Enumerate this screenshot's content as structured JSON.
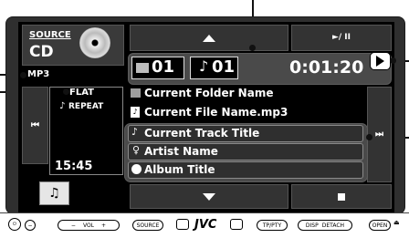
{
  "source": {
    "label": "SOURCE",
    "value": "CD"
  },
  "format": "MP3",
  "equalizer": "FLAT",
  "repeat": "REPEAT",
  "clock": "15:45",
  "folder_number": "01",
  "track_number": "01",
  "elapsed_time": "0:01:20",
  "folder_name": "Current Folder Name",
  "file_name": "Current File Name.mp3",
  "track_title": "Current Track Title",
  "artist_name": "Artist Name",
  "album_title": "Album Title",
  "play_pause_label": "►/ II",
  "panel": {
    "vol_label": "VOL",
    "source_label": "SOURCE",
    "brand": "JVC",
    "tp_label": "TP/PTY",
    "disp_label": "DISP",
    "detach_label": "DETACH",
    "open_label": "OPEN"
  }
}
